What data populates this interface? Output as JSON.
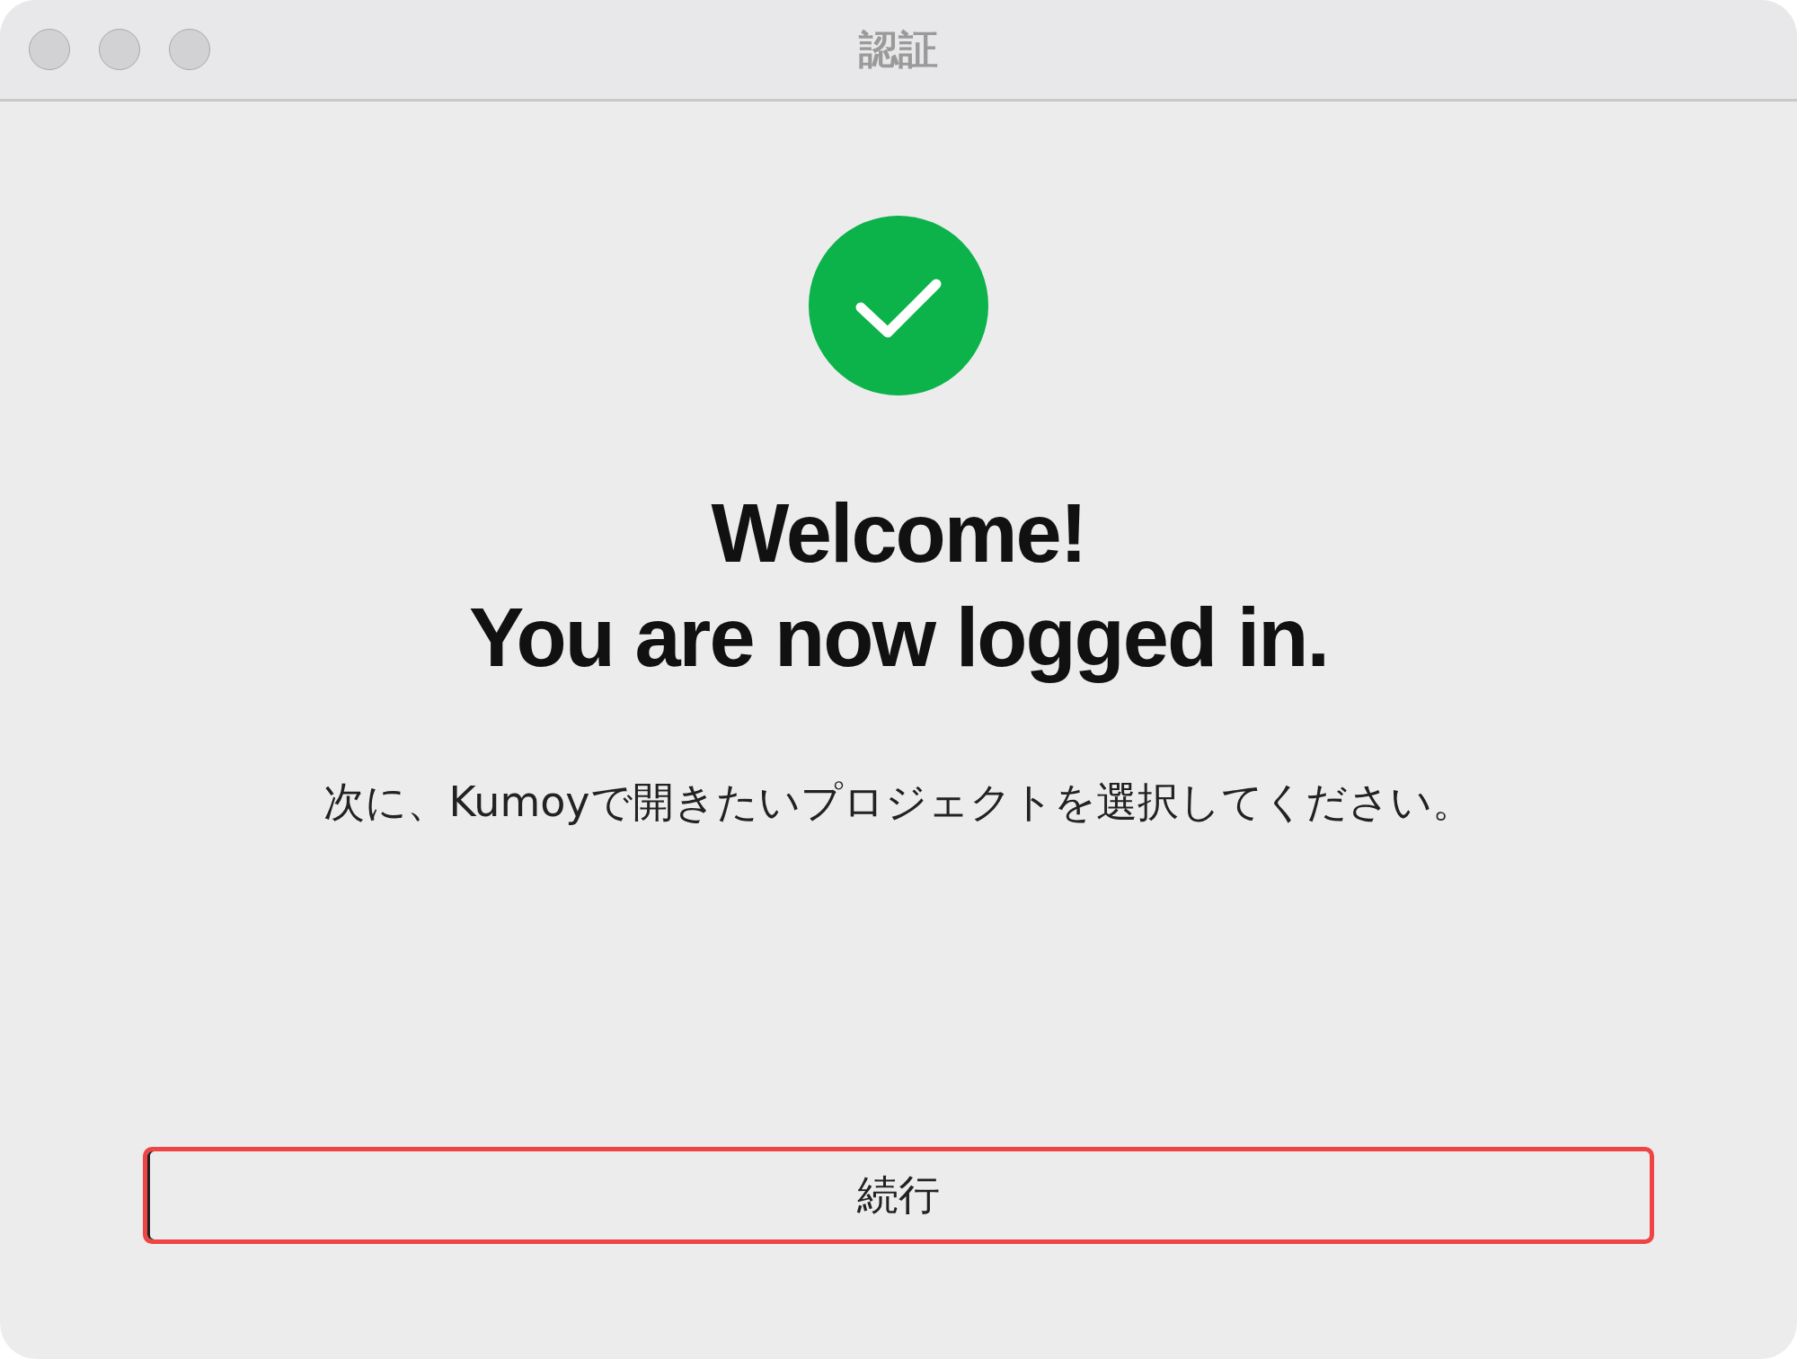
{
  "window": {
    "title": "認証"
  },
  "heading": {
    "line_1": "Welcome!",
    "line_2": "You are now logged in."
  },
  "message": "次に、Kumoyで開きたいプロジェクトを選択してください。",
  "buttons": [
    {
      "label": "続行",
      "focused": true
    }
  ]
}
